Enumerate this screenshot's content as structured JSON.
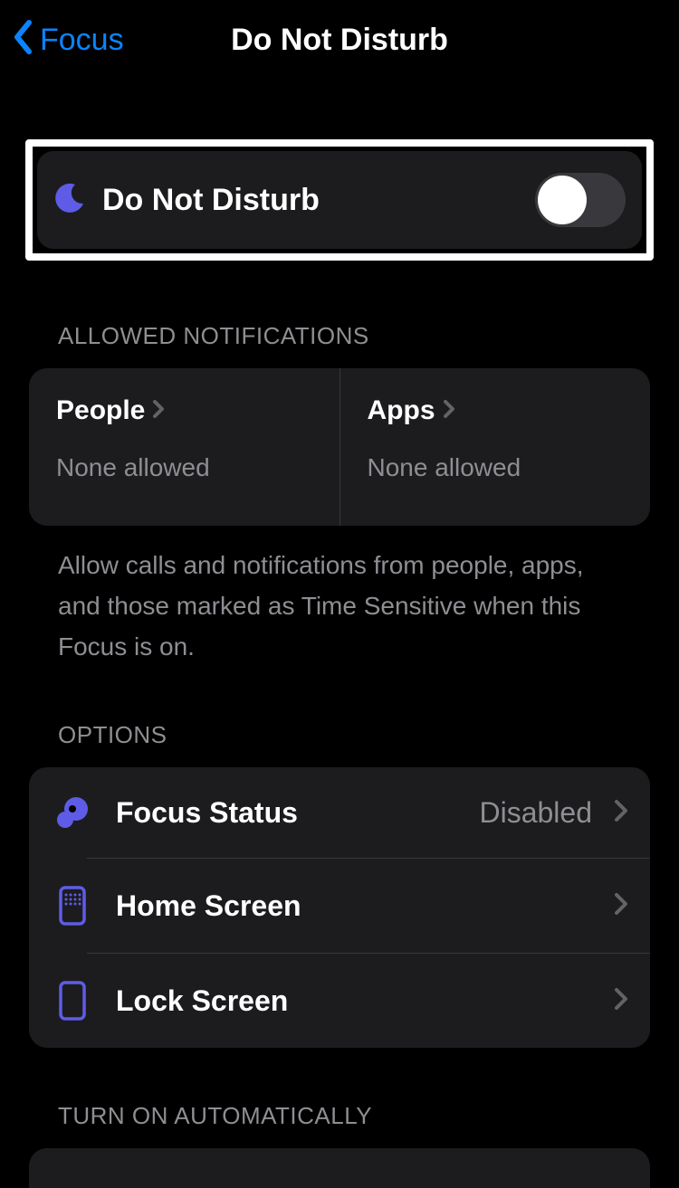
{
  "nav": {
    "back_label": "Focus",
    "title": "Do Not Disturb"
  },
  "dnd": {
    "label": "Do Not Disturb",
    "enabled": false
  },
  "allowed": {
    "section_header": "ALLOWED NOTIFICATIONS",
    "people": {
      "title": "People",
      "subtitle": "None allowed"
    },
    "apps": {
      "title": "Apps",
      "subtitle": "None allowed"
    },
    "footer": "Allow calls and notifications from people, apps, and those marked as Time Sensitive when this Focus is on."
  },
  "options": {
    "section_header": "OPTIONS",
    "items": [
      {
        "label": "Focus Status",
        "detail": "Disabled"
      },
      {
        "label": "Home Screen",
        "detail": ""
      },
      {
        "label": "Lock Screen",
        "detail": ""
      }
    ]
  },
  "auto": {
    "section_header": "TURN ON AUTOMATICALLY"
  }
}
